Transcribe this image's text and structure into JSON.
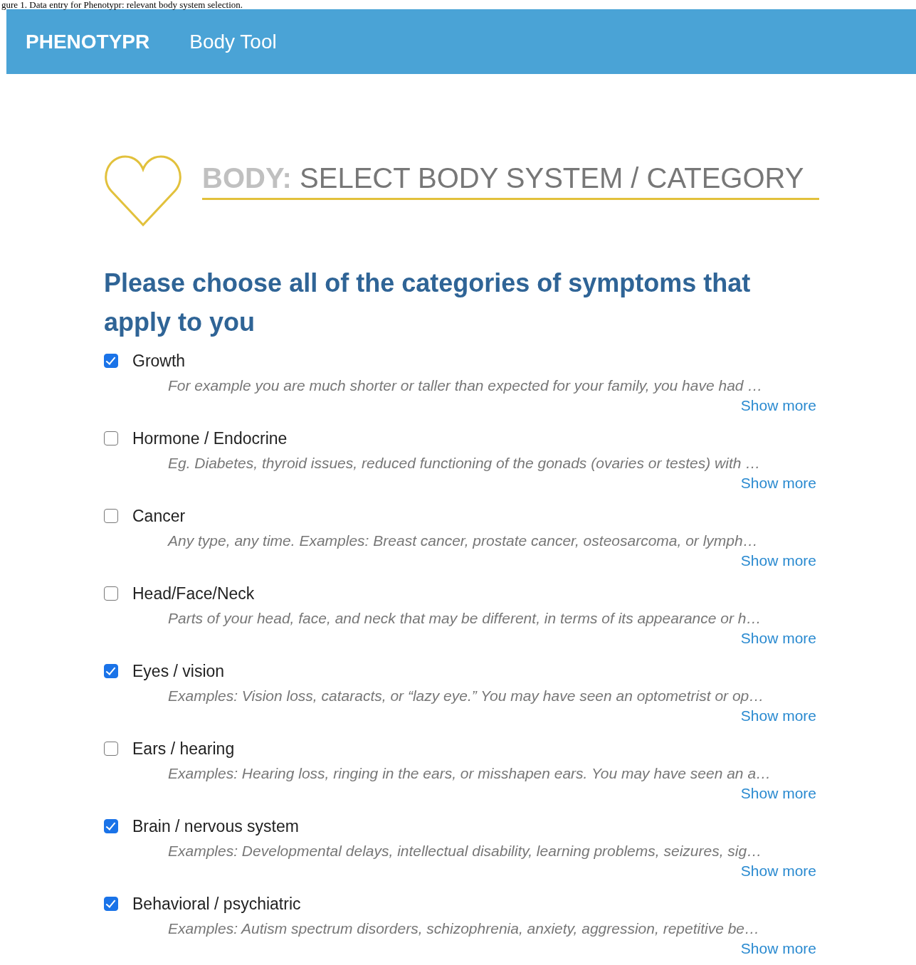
{
  "caption": "gure 1. Data entry for Phenotypr: relevant body system selection.",
  "navbar": {
    "brand": "PHENOTYPR",
    "link": "Body Tool"
  },
  "header": {
    "prefix": "BODY:",
    "title": "SELECT BODY SYSTEM / CATEGORY"
  },
  "question": "Please choose all of the categories of symptoms that apply to you",
  "categories": [
    {
      "label": "Growth",
      "checked": true,
      "description": "For example you are much shorter or taller than expected for your family, you have had …",
      "link": "Show more"
    },
    {
      "label": "Hormone / Endocrine",
      "checked": false,
      "description": "Eg. Diabetes, thyroid issues, reduced functioning of the gonads (ovaries or testes) with …",
      "link": "Show more"
    },
    {
      "label": "Cancer",
      "checked": false,
      "description": "Any type, any time. Examples: Breast cancer, prostate cancer, osteosarcoma, or lymph…",
      "link": "Show more"
    },
    {
      "label": "Head/Face/Neck",
      "checked": false,
      "description": "Parts of your head, face, and neck that may be different, in terms of its appearance or h…",
      "link": "Show more"
    },
    {
      "label": "Eyes / vision",
      "checked": true,
      "description": "Examples: Vision loss, cataracts, or “lazy eye.” You may have seen an optometrist or op…",
      "link": "Show more"
    },
    {
      "label": "Ears / hearing",
      "checked": false,
      "description": "Examples: Hearing loss, ringing in the ears, or misshapen ears. You may have seen an a…",
      "link": "Show more"
    },
    {
      "label": "Brain / nervous system",
      "checked": true,
      "description": "Examples: Developmental delays, intellectual disability, learning problems, seizures, sig…",
      "link": "Show more"
    },
    {
      "label": "Behavioral / psychiatric",
      "checked": true,
      "description": "Examples: Autism spectrum disorders, schizophrenia, anxiety, aggression, repetitive be…",
      "link": "Show more"
    }
  ]
}
